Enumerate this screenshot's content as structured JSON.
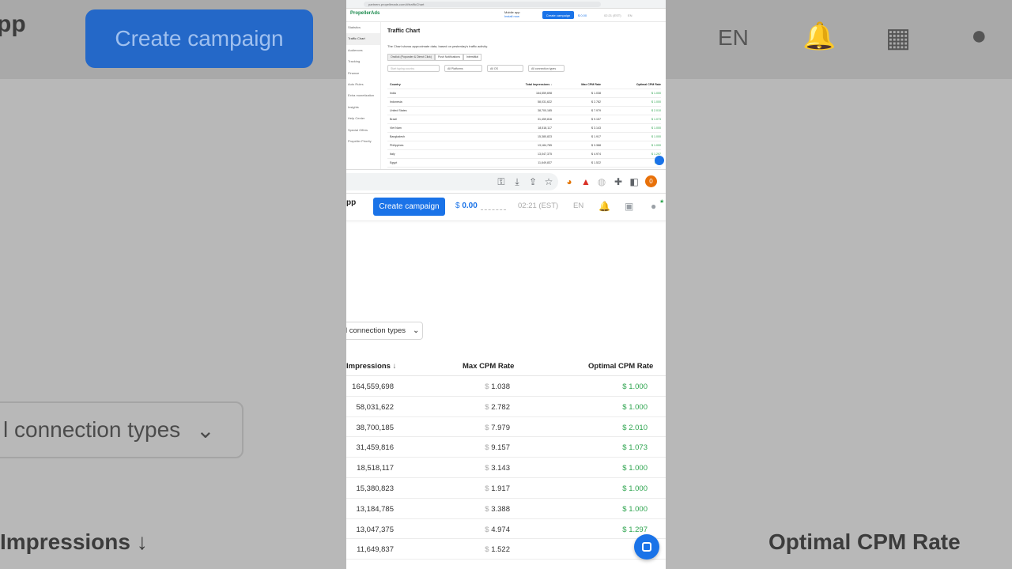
{
  "background": {
    "left_text": "pp",
    "create_btn": "Create campaign",
    "lang": "EN",
    "conn_types": "l connection types",
    "impressions": "Impressions ↓",
    "optimal": "Optimal CPM Rate"
  },
  "mini": {
    "url": "partners.propellerads.com/#/trafficChart",
    "logo": "PropellerAds",
    "mobile_app": "Mobile app",
    "mobile_sub": "Install now",
    "create": "Create campaign",
    "balance": "$ 0.00",
    "time": "02:21 (EST)",
    "lang": "EN",
    "sidebar": [
      "Statistics",
      "Traffic Chart",
      "Audiences",
      "Tracking",
      "Finance",
      "Auto Rules",
      "Extra monetization",
      "Insights",
      "Help Center",
      "Special Offers",
      "Propeller Priority"
    ],
    "title": "Traffic Chart",
    "description": "The Chart shows approximate data, based on yesterday's traffic activity.",
    "tabs": [
      "Onclick (Popunder & Direct Click)",
      "Push Notifications",
      "Interstitial"
    ],
    "filters": [
      "Start typing country",
      "All Platforms",
      "All OS",
      "All connection types"
    ],
    "headers": [
      "Country",
      "Total Impressions ↓",
      "Max CPM Rate",
      "Optimal CPM Rate"
    ],
    "rows": [
      [
        "India",
        "164,559,698",
        "$ 1.038",
        "$ 1.000"
      ],
      [
        "Indonesia",
        "58,031,622",
        "$ 2.782",
        "$ 1.000"
      ],
      [
        "United States",
        "38,700,185",
        "$ 7.979",
        "$ 2.010"
      ],
      [
        "Brazil",
        "31,459,816",
        "$ 9.157",
        "$ 1.073"
      ],
      [
        "Viet Nam",
        "18,518,117",
        "$ 3.143",
        "$ 1.000"
      ],
      [
        "Bangladesh",
        "15,380,823",
        "$ 1.917",
        "$ 1.000"
      ],
      [
        "Philippines",
        "13,184,785",
        "$ 3.388",
        "$ 1.000"
      ],
      [
        "Italy",
        "13,047,375",
        "$ 4.974",
        "$ 1.297"
      ],
      [
        "Egypt",
        "11,649,837",
        "$ 1.522",
        "$ 1.0"
      ]
    ]
  },
  "chrome": {
    "profile_initial": "0"
  },
  "header": {
    "logo": "pp",
    "create_label": "Create campaign",
    "balance_symbol": "$",
    "balance_value": "0.00",
    "time": "02:21 (EST)",
    "lang": "EN"
  },
  "filter": {
    "connection_types": "l connection types"
  },
  "table": {
    "headers": {
      "impressions": "Impressions",
      "max": "Max CPM Rate",
      "optimal": "Optimal CPM Rate"
    },
    "rows": [
      {
        "impressions": "164,559,698",
        "max": "1.038",
        "optimal": "1.000"
      },
      {
        "impressions": "58,031,622",
        "max": "2.782",
        "optimal": "1.000"
      },
      {
        "impressions": "38,700,185",
        "max": "7.979",
        "optimal": "2.010"
      },
      {
        "impressions": "31,459,816",
        "max": "9.157",
        "optimal": "1.073"
      },
      {
        "impressions": "18,518,117",
        "max": "3.143",
        "optimal": "1.000"
      },
      {
        "impressions": "15,380,823",
        "max": "1.917",
        "optimal": "1.000"
      },
      {
        "impressions": "13,184,785",
        "max": "3.388",
        "optimal": "1.000"
      },
      {
        "impressions": "13,047,375",
        "max": "4.974",
        "optimal": "1.297"
      },
      {
        "impressions": "11,649,837",
        "max": "1.522",
        "optimal": "1."
      }
    ]
  },
  "colors": {
    "accent": "#1a73e8",
    "green": "#2da44e"
  }
}
